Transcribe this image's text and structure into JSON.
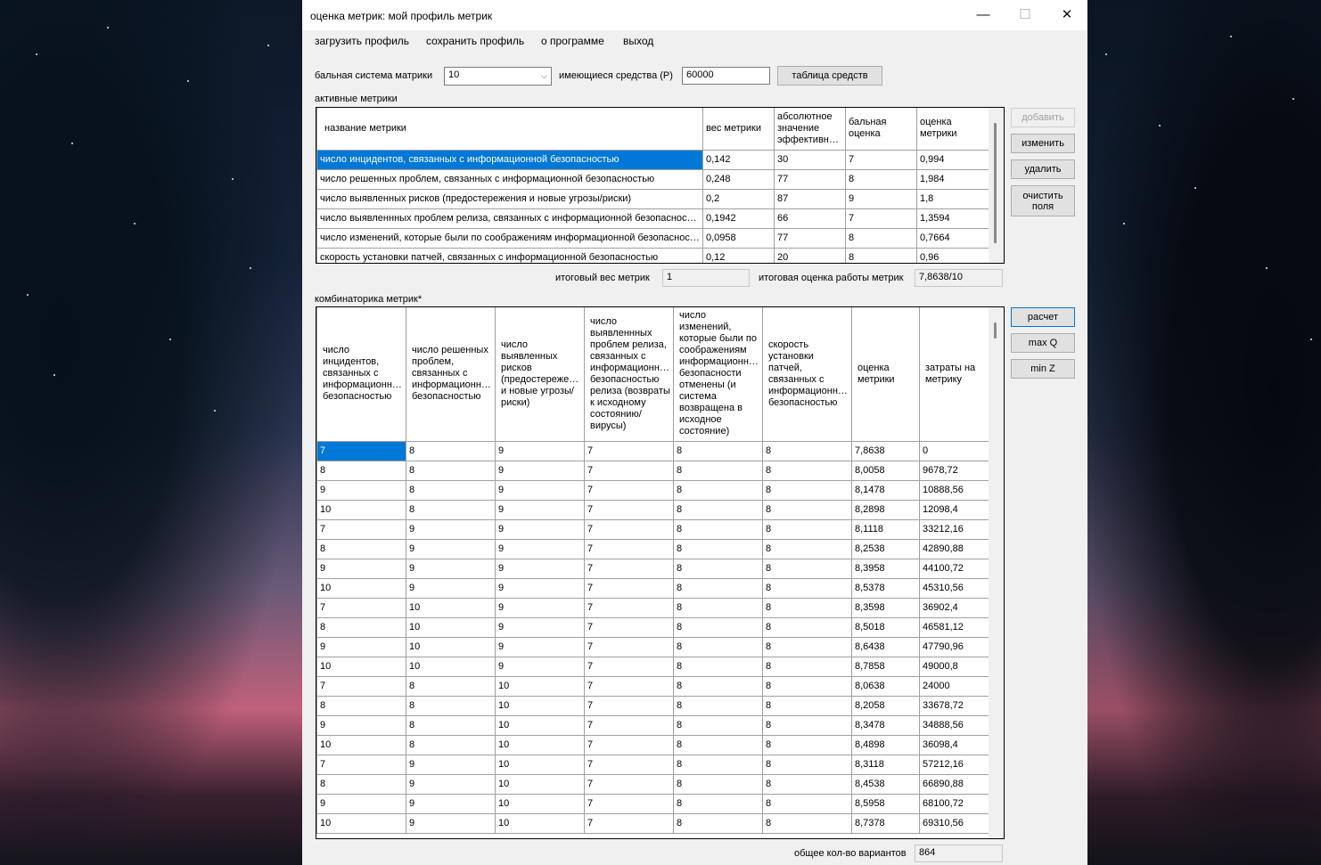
{
  "window": {
    "title": "оценка метрик: мой профиль метрик",
    "controls": [
      "—",
      "☐",
      "✕"
    ]
  },
  "menu": [
    "загрузить профиль",
    "сохранить профиль",
    "о программе",
    "выход"
  ],
  "settings": {
    "scale_label": "бальная система матрики",
    "scale_value": "10",
    "funds_label": "имеющиеся средства (Р)",
    "funds_value": "60000",
    "funds_table_button": "таблица средств"
  },
  "active": {
    "section_label": "активные метрики",
    "columns": [
      "название метрики",
      "вес метрики",
      "абсолютное значение эффективности",
      "бальная оценка",
      "оценка метрики"
    ],
    "rows": [
      [
        "число инцидентов, связанных с информационной безопасностью",
        "0,142",
        "30",
        "7",
        "0,994"
      ],
      [
        "число решенных проблем, связанных с информационной безопасностью",
        "0,248",
        "77",
        "8",
        "1,984"
      ],
      [
        "число выявленных рисков (предостережения и новые угрозы/риски)",
        "0,2",
        "87",
        "9",
        "1,8"
      ],
      [
        "число выявленнных проблем релиза, связанных с информационной безопасностью",
        "0,1942",
        "66",
        "7",
        "1,3594"
      ],
      [
        "число изменений, которые были по соображениям информационной безопасности отменены",
        "0,0958",
        "77",
        "8",
        "0,7664"
      ],
      [
        "скорость установки патчей, связанных с информационной безопасностью",
        "0,12",
        "20",
        "8",
        "0,96"
      ]
    ],
    "buttons": {
      "add": "добавить",
      "edit": "изменить",
      "delete": "удалить",
      "clear": "очистить поля"
    },
    "total_weight_label": "итоговый вес метрик",
    "total_weight_value": "1",
    "total_score_label": "итоговая оценка работы метрик",
    "total_score_value": "7,8638/10"
  },
  "combo": {
    "section_label": "комбинаторика метрик*",
    "columns": [
      "число инцидентов, связанных с информационной безопасностью",
      "число решенных проблем, связанных с информационной безопасностью",
      "число выявленных рисков (предостережения и новые угрозы/риски)",
      "число выявленнных проблем релиза, связанных с информационной безопасностью релиза (возвраты к исходному состоянию/вирусы)",
      "число изменений, которые были по соображениям информационной безопасности отменены (и система возвращена в исходное состояние)",
      "скорость установки патчей, связанных с информационной безопасностью",
      "оценка метрики",
      "затраты на метрику"
    ],
    "rows": [
      [
        "7",
        "8",
        "9",
        "7",
        "8",
        "8",
        "7,8638",
        "0"
      ],
      [
        "8",
        "8",
        "9",
        "7",
        "8",
        "8",
        "8,0058",
        "9678,72"
      ],
      [
        "9",
        "8",
        "9",
        "7",
        "8",
        "8",
        "8,1478",
        "10888,56"
      ],
      [
        "10",
        "8",
        "9",
        "7",
        "8",
        "8",
        "8,2898",
        "12098,4"
      ],
      [
        "7",
        "9",
        "9",
        "7",
        "8",
        "8",
        "8,1118",
        "33212,16"
      ],
      [
        "8",
        "9",
        "9",
        "7",
        "8",
        "8",
        "8,2538",
        "42890,88"
      ],
      [
        "9",
        "9",
        "9",
        "7",
        "8",
        "8",
        "8,3958",
        "44100,72"
      ],
      [
        "10",
        "9",
        "9",
        "7",
        "8",
        "8",
        "8,5378",
        "45310,56"
      ],
      [
        "7",
        "10",
        "9",
        "7",
        "8",
        "8",
        "8,3598",
        "36902,4"
      ],
      [
        "8",
        "10",
        "9",
        "7",
        "8",
        "8",
        "8,5018",
        "46581,12"
      ],
      [
        "9",
        "10",
        "9",
        "7",
        "8",
        "8",
        "8,6438",
        "47790,96"
      ],
      [
        "10",
        "10",
        "9",
        "7",
        "8",
        "8",
        "8,7858",
        "49000,8"
      ],
      [
        "7",
        "8",
        "10",
        "7",
        "8",
        "8",
        "8,0638",
        "24000"
      ],
      [
        "8",
        "8",
        "10",
        "7",
        "8",
        "8",
        "8,2058",
        "33678,72"
      ],
      [
        "9",
        "8",
        "10",
        "7",
        "8",
        "8",
        "8,3478",
        "34888,56"
      ],
      [
        "10",
        "8",
        "10",
        "7",
        "8",
        "8",
        "8,4898",
        "36098,4"
      ],
      [
        "7",
        "9",
        "10",
        "7",
        "8",
        "8",
        "8,3118",
        "57212,16"
      ],
      [
        "8",
        "9",
        "10",
        "7",
        "8",
        "8",
        "8,4538",
        "66890,88"
      ],
      [
        "9",
        "9",
        "10",
        "7",
        "8",
        "8",
        "8,5958",
        "68100,72"
      ],
      [
        "10",
        "9",
        "10",
        "7",
        "8",
        "8",
        "8,7378",
        "69310,56"
      ]
    ],
    "buttons": {
      "calc": "расчет",
      "max": "max Q",
      "min": "min Z"
    },
    "total_label": "общее кол-во вариантов",
    "total_value": "864"
  }
}
